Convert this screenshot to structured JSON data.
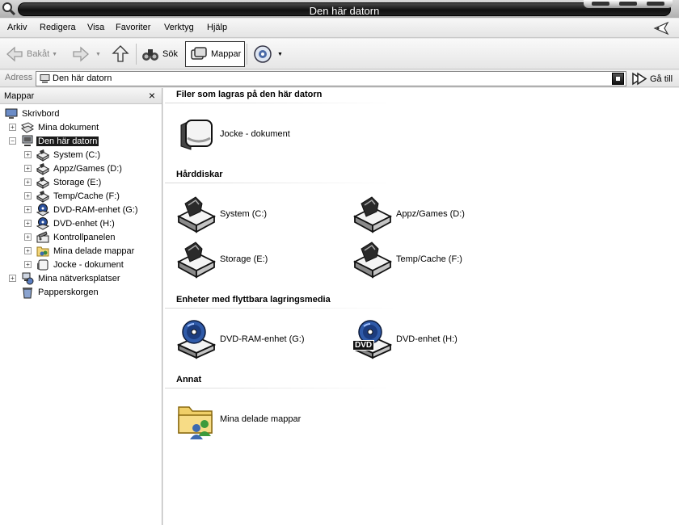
{
  "window": {
    "title": "Den här datorn"
  },
  "menu": [
    "Arkiv",
    "Redigera",
    "Visa",
    "Favoriter",
    "Verktyg",
    "Hjälp"
  ],
  "toolbar": {
    "back": "Bakåt",
    "search": "Sök",
    "folders": "Mappar"
  },
  "address": {
    "label": "Adress",
    "value": "Den här datorn",
    "go": "Gå till"
  },
  "folders_pane": {
    "title": "Mappar",
    "close": "×",
    "tree": [
      {
        "label": "Skrivbord",
        "icon": "desktop-icon",
        "expander": "none",
        "selected": false
      },
      {
        "label": "Mina dokument",
        "icon": "my-documents-icon",
        "expander": "+",
        "selected": false
      },
      {
        "label": "Den här datorn",
        "icon": "computer-icon",
        "expander": "-",
        "selected": true
      },
      {
        "label": "System (C:)",
        "icon": "hard-drive-icon",
        "expander": "+",
        "selected": false
      },
      {
        "label": "Appz/Games (D:)",
        "icon": "hard-drive-icon",
        "expander": "+",
        "selected": false
      },
      {
        "label": "Storage (E:)",
        "icon": "hard-drive-icon",
        "expander": "+",
        "selected": false
      },
      {
        "label": "Temp/Cache (F:)",
        "icon": "hard-drive-icon",
        "expander": "+",
        "selected": false
      },
      {
        "label": "DVD-RAM-enhet (G:)",
        "icon": "dvd-drive-icon",
        "expander": "+",
        "selected": false
      },
      {
        "label": "DVD-enhet (H:)",
        "icon": "dvd-drive-icon",
        "expander": "+",
        "selected": false
      },
      {
        "label": "Kontrollpanelen",
        "icon": "control-panel-icon",
        "expander": "+",
        "selected": false
      },
      {
        "label": "Mina delade mappar",
        "icon": "shared-folder-icon",
        "expander": "+",
        "selected": false
      },
      {
        "label": "Jocke - dokument",
        "icon": "user-documents-icon",
        "expander": "+",
        "selected": false
      },
      {
        "label": "Mina nätverksplatser",
        "icon": "network-places-icon",
        "expander": "+",
        "selected": false
      },
      {
        "label": "Papperskorgen",
        "icon": "recycle-bin-icon",
        "expander": "none",
        "selected": false
      }
    ]
  },
  "groups": [
    {
      "header": "Filer som lagras på den här datorn",
      "items": [
        {
          "label": "Jocke - dokument",
          "icon": "user-documents-icon"
        }
      ]
    },
    {
      "header": "Hårddiskar",
      "items": [
        {
          "label": "System (C:)",
          "icon": "hard-drive-icon"
        },
        {
          "label": "Appz/Games (D:)",
          "icon": "hard-drive-icon"
        },
        {
          "label": "Storage (E:)",
          "icon": "hard-drive-icon"
        },
        {
          "label": "Temp/Cache (F:)",
          "icon": "hard-drive-icon"
        }
      ]
    },
    {
      "header": "Enheter med flyttbara lagringsmedia",
      "items": [
        {
          "label": "DVD-RAM-enhet (G:)",
          "icon": "dvd-drive-icon"
        },
        {
          "label": "DVD-enhet (H:)",
          "icon": "dvd-drive-icon",
          "badge": "DVD"
        }
      ]
    },
    {
      "header": "Annat",
      "items": [
        {
          "label": "Mina delade mappar",
          "icon": "shared-folder-icon"
        }
      ]
    }
  ]
}
